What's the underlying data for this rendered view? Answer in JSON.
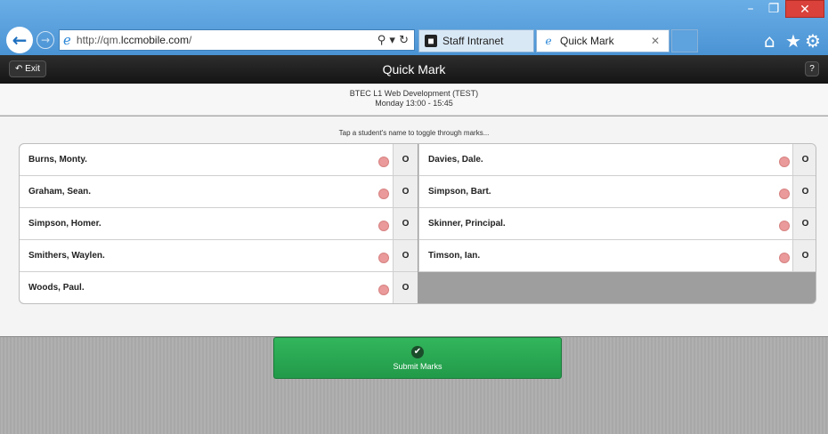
{
  "browser": {
    "url_prefix": "http://qm.",
    "url_domain": "lccmobile.com",
    "url_suffix": "/",
    "tabs": [
      {
        "label": "Staff Intranet"
      },
      {
        "label": "Quick Mark"
      }
    ]
  },
  "app": {
    "exit_label": "Exit",
    "title": "Quick Mark",
    "help_label": "?"
  },
  "course": {
    "name": "BTEC L1 Web Development (TEST)",
    "session": "Monday 13:00 - 15:45"
  },
  "hint": "Tap a student's name to toggle through marks...",
  "students": [
    {
      "name": "Burns, Monty.",
      "mark": "O"
    },
    {
      "name": "Davies, Dale.",
      "mark": "O"
    },
    {
      "name": "Graham, Sean.",
      "mark": "O"
    },
    {
      "name": "Simpson, Bart.",
      "mark": "O"
    },
    {
      "name": "Simpson, Homer.",
      "mark": "O"
    },
    {
      "name": "Skinner, Principal.",
      "mark": "O"
    },
    {
      "name": "Smithers, Waylen.",
      "mark": "O"
    },
    {
      "name": "Timson, Ian.",
      "mark": "O"
    },
    {
      "name": "Woods, Paul.",
      "mark": "O"
    }
  ],
  "submit_label": "Submit Marks",
  "colors": {
    "submit_green": "#27a851",
    "status_dot": "#ea9a9a",
    "header_dark": "#1f1f1f"
  }
}
